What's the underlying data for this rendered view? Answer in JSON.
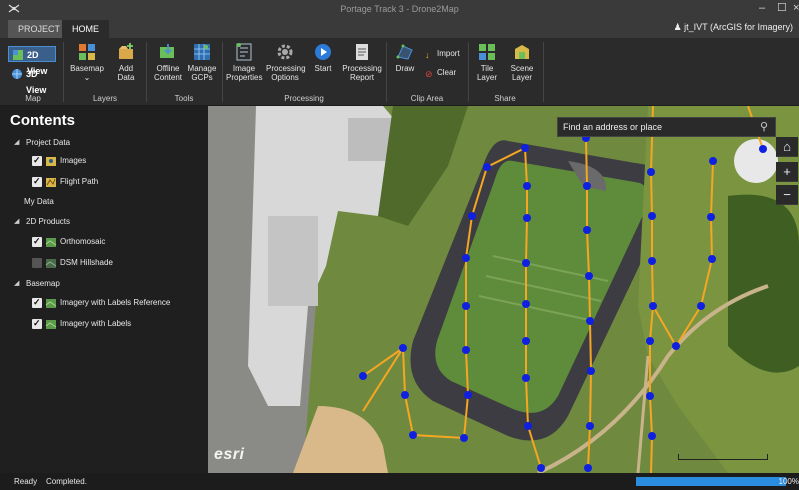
{
  "window": {
    "title": "Portage Track 3 - Drone2Map",
    "min_glyph": "–",
    "max_glyph": "☐",
    "close_glyph": "×"
  },
  "tabs": [
    {
      "label": "PROJECT"
    },
    {
      "label": "HOME"
    }
  ],
  "user": {
    "label": "jt_IVT (ArcGIS for Imagery)"
  },
  "ribbon": {
    "map_group": {
      "label": "Map",
      "view_2d": "2D View",
      "view_3d": "3D View"
    },
    "layers_group": {
      "label": "Layers",
      "basemap": "Basemap",
      "add_data": "Add\nData"
    },
    "tools_group": {
      "label": "Tools",
      "offline_content": "Offline\nContent",
      "manage_gcps": "Manage\nGCPs"
    },
    "processing_group": {
      "label": "Processing",
      "image_properties": "Image\nProperties",
      "processing_options": "Processing\nOptions",
      "start": "Start",
      "processing_report": "Processing\nReport"
    },
    "clip_group": {
      "label": "Clip Area",
      "draw": "Draw",
      "import": "Import",
      "clear": "Clear"
    },
    "share_group": {
      "label": "Share",
      "tile_layer": "Tile\nLayer",
      "scene_layer": "Scene\nLayer"
    }
  },
  "contents": {
    "title": "Contents",
    "project_data": {
      "label": "Project Data",
      "images": "Images",
      "flight_path": "Flight Path"
    },
    "my_data": {
      "label": "My Data"
    },
    "products_2d": {
      "label": "2D Products",
      "orthomosaic": "Orthomosaic",
      "dsm_hillshade": "DSM Hillshade"
    },
    "basemap": {
      "label": "Basemap",
      "imagery_labels_ref": "Imagery with Labels Reference",
      "imagery_labels": "Imagery with Labels"
    }
  },
  "layers_checked": {
    "images": true,
    "flight_path": true,
    "orthomosaic": true,
    "dsm_hillshade": false,
    "imagery_labels_ref": true,
    "imagery_labels": true
  },
  "map": {
    "search_placeholder": "Find an address or place",
    "esri_logo": "esri",
    "flight_path_color": "#f5a623",
    "image_point_color": "#1020e0"
  },
  "status": {
    "ready": "Ready",
    "message": "Completed.",
    "progress_percent": 100,
    "progress_text": "100%"
  },
  "colors": {
    "accent": "#2b8de0",
    "background": "#2b2b2b",
    "panel": "#1f1f1f"
  }
}
